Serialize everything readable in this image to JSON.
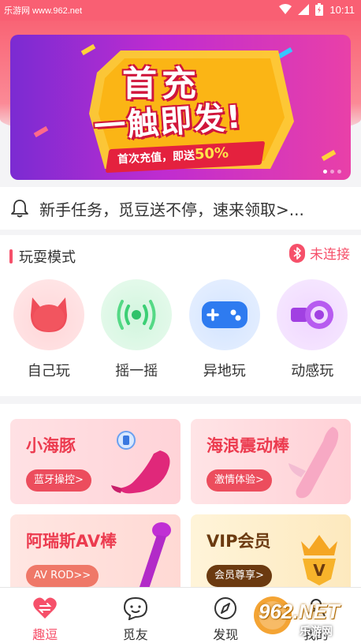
{
  "status_bar": {
    "source": "乐游网 www.962.net",
    "time": "10:11"
  },
  "banner": {
    "title_line1": "首充",
    "title_line2": "一触即发!",
    "subtitle": "首次充值，即送",
    "percent": "50%"
  },
  "notice": {
    "text": "新手任务，觅豆送不停，速来领取>..."
  },
  "modes": {
    "title": "玩耍模式",
    "connection_status": "未连接",
    "items": [
      {
        "label": "自己玩",
        "icon": "devil-face-icon"
      },
      {
        "label": "摇一摇",
        "icon": "vibration-signal-icon"
      },
      {
        "label": "异地玩",
        "icon": "gamepad-icon"
      },
      {
        "label": "动感玩",
        "icon": "speaker-wave-icon"
      }
    ]
  },
  "products": [
    {
      "title": "小海豚",
      "button": "蓝牙操控>",
      "title_color": "#ec3b4f",
      "button_color": "#ec4d5d"
    },
    {
      "title": "海浪震动棒",
      "button": "激情体验>",
      "title_color": "#ec3b4f",
      "button_color": "#ec4d5d"
    },
    {
      "title": "阿瑞斯AV棒",
      "button": "AV ROD>>",
      "title_color": "#ec3b4f",
      "button_color": "#ef7868"
    },
    {
      "title": "VIP会员",
      "button": "会员尊享>",
      "title_color": "#6b3a10",
      "button_color": "#6b3a10"
    }
  ],
  "tabbar": {
    "items": [
      {
        "label": "趣逗",
        "icon": "heart-icon",
        "active": true
      },
      {
        "label": "觅友",
        "icon": "chat-face-icon",
        "active": false
      },
      {
        "label": "发现",
        "icon": "compass-icon",
        "active": false
      },
      {
        "label": "我的",
        "icon": "person-icon",
        "active": false
      }
    ]
  },
  "watermark": {
    "line1": "962.NET",
    "line2": "乐游网"
  },
  "colors": {
    "accent": "#f6506a",
    "status_bar": "#f95f73"
  }
}
